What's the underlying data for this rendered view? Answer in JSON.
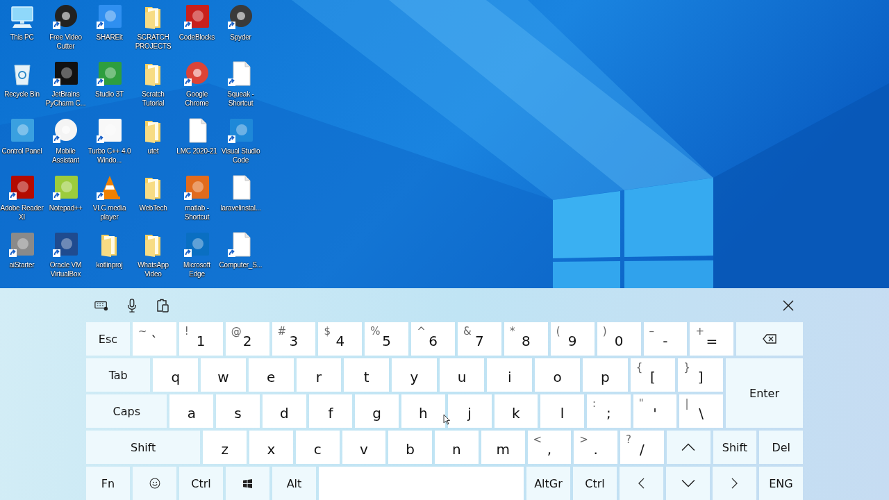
{
  "desktop": {
    "icons": [
      {
        "label": "This PC",
        "kind": "pc",
        "shortcut": false
      },
      {
        "label": "Free Video Cutter",
        "kind": "circle",
        "color": "#222222",
        "shortcut": true
      },
      {
        "label": "SHAREit",
        "kind": "tile",
        "color": "#2f8ff0",
        "shortcut": true
      },
      {
        "label": "SCRATCH PROJECTS",
        "kind": "folder",
        "shortcut": false
      },
      {
        "label": "CodeBlocks",
        "kind": "tile",
        "color": "#c8201c",
        "shortcut": true
      },
      {
        "label": "Spyder",
        "kind": "circle",
        "color": "#3a3a3a",
        "shortcut": true
      },
      {
        "label": "Recycle Bin",
        "kind": "recycle",
        "shortcut": false
      },
      {
        "label": "JetBrains PyCharm C...",
        "kind": "tile",
        "color": "#111111",
        "shortcut": true
      },
      {
        "label": "Studio 3T",
        "kind": "tile",
        "color": "#2e9e3e",
        "shortcut": true
      },
      {
        "label": "Scratch Tutorial",
        "kind": "folder",
        "shortcut": false
      },
      {
        "label": "Google Chrome",
        "kind": "circle",
        "color": "#db4437",
        "shortcut": true
      },
      {
        "label": "Squeak - Shortcut",
        "kind": "document",
        "shortcut": true
      },
      {
        "label": "Control Panel",
        "kind": "tile",
        "color": "#3aa0e0",
        "shortcut": false
      },
      {
        "label": "Mobile Assistant",
        "kind": "circle",
        "color": "#f4f4f4",
        "shortcut": true
      },
      {
        "label": "Turbo C++ 4.0 Windo...",
        "kind": "tile",
        "color": "#f8f8f8",
        "shortcut": true
      },
      {
        "label": "utet",
        "kind": "folder",
        "shortcut": false
      },
      {
        "label": "LMC 2020-21",
        "kind": "document",
        "shortcut": false
      },
      {
        "label": "Visual Studio Code",
        "kind": "tile",
        "color": "#1e88d8",
        "shortcut": true
      },
      {
        "label": "Adobe Reader XI",
        "kind": "tile",
        "color": "#b30b00",
        "shortcut": true
      },
      {
        "label": "Notepad++",
        "kind": "tile",
        "color": "#9ccc3c",
        "shortcut": true
      },
      {
        "label": "VLC media player",
        "kind": "cone",
        "color": "#f08000",
        "shortcut": true
      },
      {
        "label": "WebTech",
        "kind": "folder",
        "shortcut": false
      },
      {
        "label": "matlab - Shortcut",
        "kind": "tile",
        "color": "#e16b1d",
        "shortcut": true
      },
      {
        "label": "laravelinstal...",
        "kind": "document",
        "shortcut": false
      },
      {
        "label": "aiStarter",
        "kind": "tile",
        "color": "#8a8a8a",
        "shortcut": true
      },
      {
        "label": "Oracle VM VirtualBox",
        "kind": "tile",
        "color": "#1f4b8f",
        "shortcut": true
      },
      {
        "label": "kotlinproj",
        "kind": "folder",
        "shortcut": false
      },
      {
        "label": "WhatsApp Video",
        "kind": "folder",
        "shortcut": false
      },
      {
        "label": "Microsoft Edge",
        "kind": "tile",
        "color": "#0a6fc2",
        "shortcut": true
      },
      {
        "label": "Computer_S...",
        "kind": "document",
        "shortcut": true
      }
    ]
  },
  "keyboard": {
    "rows": [
      [
        {
          "kind": "func",
          "label": "Esc"
        },
        {
          "kind": "char",
          "main": "`",
          "shift": "~"
        },
        {
          "kind": "char",
          "main": "1",
          "shift": "!"
        },
        {
          "kind": "char",
          "main": "2",
          "shift": "@"
        },
        {
          "kind": "char",
          "main": "3",
          "shift": "#"
        },
        {
          "kind": "char",
          "main": "4",
          "shift": "$"
        },
        {
          "kind": "char",
          "main": "5",
          "shift": "%"
        },
        {
          "kind": "char",
          "main": "6",
          "shift": "^"
        },
        {
          "kind": "char",
          "main": "7",
          "shift": "&"
        },
        {
          "kind": "char",
          "main": "8",
          "shift": "*"
        },
        {
          "kind": "char",
          "main": "9",
          "shift": "("
        },
        {
          "kind": "char",
          "main": "0",
          "shift": ")"
        },
        {
          "kind": "char",
          "main": "-",
          "shift": "–"
        },
        {
          "kind": "char",
          "main": "=",
          "shift": "+"
        },
        {
          "kind": "backspace"
        }
      ],
      [
        {
          "kind": "func",
          "label": "Tab"
        },
        {
          "kind": "char",
          "main": "q"
        },
        {
          "kind": "char",
          "main": "w"
        },
        {
          "kind": "char",
          "main": "e"
        },
        {
          "kind": "char",
          "main": "r"
        },
        {
          "kind": "char",
          "main": "t"
        },
        {
          "kind": "char",
          "main": "y"
        },
        {
          "kind": "char",
          "main": "u"
        },
        {
          "kind": "char",
          "main": "i"
        },
        {
          "kind": "char",
          "main": "o"
        },
        {
          "kind": "char",
          "main": "p"
        },
        {
          "kind": "char",
          "main": "[",
          "shift": "{"
        },
        {
          "kind": "char",
          "main": "]",
          "shift": "}"
        }
      ],
      [
        {
          "kind": "func",
          "label": "Caps"
        },
        {
          "kind": "char",
          "main": "a"
        },
        {
          "kind": "char",
          "main": "s"
        },
        {
          "kind": "char",
          "main": "d"
        },
        {
          "kind": "char",
          "main": "f"
        },
        {
          "kind": "char",
          "main": "g"
        },
        {
          "kind": "char",
          "main": "h"
        },
        {
          "kind": "char",
          "main": "j"
        },
        {
          "kind": "char",
          "main": "k"
        },
        {
          "kind": "char",
          "main": "l"
        },
        {
          "kind": "char",
          "main": ";",
          "shift": ":"
        },
        {
          "kind": "char",
          "main": "'",
          "shift": "\""
        },
        {
          "kind": "char",
          "main": "\\",
          "shift": "|"
        }
      ],
      [
        {
          "kind": "func",
          "label": "Shift"
        },
        {
          "kind": "char",
          "main": "z"
        },
        {
          "kind": "char",
          "main": "x"
        },
        {
          "kind": "char",
          "main": "c"
        },
        {
          "kind": "char",
          "main": "v"
        },
        {
          "kind": "char",
          "main": "b"
        },
        {
          "kind": "char",
          "main": "n"
        },
        {
          "kind": "char",
          "main": "m"
        },
        {
          "kind": "char",
          "main": ",",
          "shift": "<"
        },
        {
          "kind": "char",
          "main": ".",
          "shift": ">"
        },
        {
          "kind": "char",
          "main": "/",
          "shift": "?"
        },
        {
          "kind": "up"
        },
        {
          "kind": "func",
          "label": "Shift"
        },
        {
          "kind": "func",
          "label": "Del"
        }
      ],
      [
        {
          "kind": "func",
          "label": "Fn"
        },
        {
          "kind": "emoji"
        },
        {
          "kind": "func",
          "label": "Ctrl"
        },
        {
          "kind": "windows"
        },
        {
          "kind": "func",
          "label": "Alt"
        },
        {
          "kind": "space"
        },
        {
          "kind": "func",
          "label": "AltGr"
        },
        {
          "kind": "func",
          "label": "Ctrl"
        },
        {
          "kind": "left"
        },
        {
          "kind": "down"
        },
        {
          "kind": "right"
        },
        {
          "kind": "func",
          "label": "ENG"
        }
      ]
    ],
    "enter": "Enter"
  }
}
